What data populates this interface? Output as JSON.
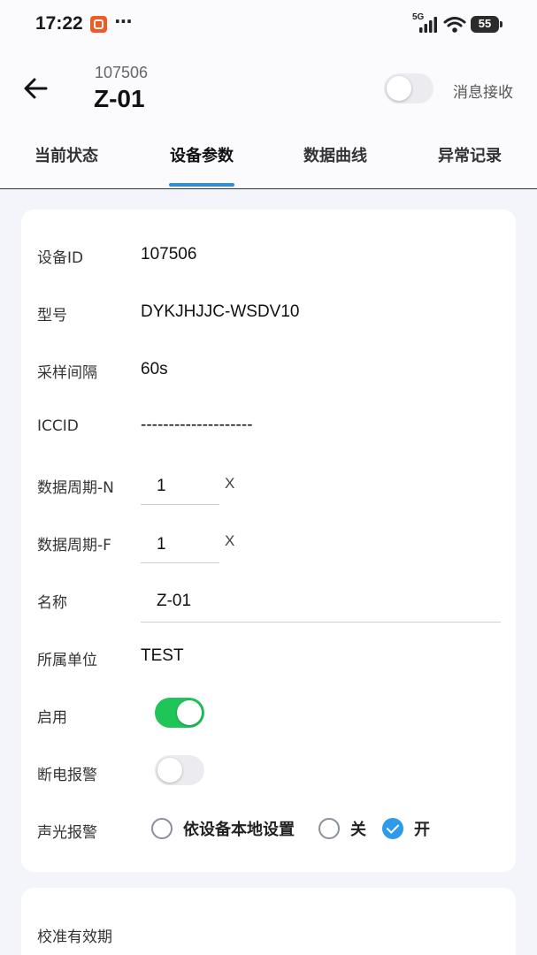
{
  "status_bar": {
    "time": "17:22",
    "more": "···",
    "network": "5G",
    "battery": "55"
  },
  "header": {
    "device_id": "107506",
    "device_name": "Z-01",
    "message_receive_label": "消息接收",
    "message_receive_on": false
  },
  "tabs": [
    {
      "label": "当前状态",
      "active": false
    },
    {
      "label": "设备参数",
      "active": true
    },
    {
      "label": "数据曲线",
      "active": false
    },
    {
      "label": "异常记录",
      "active": false
    }
  ],
  "params": {
    "device_id_label": "设备ID",
    "device_id_value": "107506",
    "model_label": "型号",
    "model_value": "DYKJHJJC-WSDV10",
    "sample_label": "采样间隔",
    "sample_value": "60s",
    "iccid_label": "ICCID",
    "iccid_value": "--------------------",
    "period_n_label": "数据周期-N",
    "period_n_value": "1",
    "period_f_label": "数据周期-F",
    "period_f_value": "1",
    "unit_x": "X",
    "name_label": "名称",
    "name_value": "Z-01",
    "org_label": "所属单位",
    "org_value": "TEST",
    "enable_label": "启用",
    "enable_on": true,
    "power_alarm_label": "断电报警",
    "power_alarm_on": false,
    "sound_alarm_label": "声光报警",
    "sound_alarm_options": [
      "依设备本地设置",
      "关",
      "开"
    ],
    "sound_alarm_selected": "开"
  },
  "calibration": {
    "label": "校准有效期"
  },
  "colors": {
    "accent": "#2b8fe0",
    "switch_on": "#20c55a",
    "radio_checked": "#2f9aea",
    "background": "#f4f5fb"
  }
}
